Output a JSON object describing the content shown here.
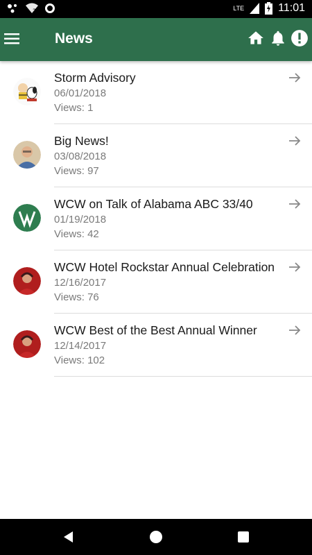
{
  "status_bar": {
    "time": "11:01",
    "network": "LTE",
    "icons": [
      "notification-dots-icon",
      "wifi-icon",
      "circle-icon",
      "signal-icon",
      "battery-charging-icon"
    ]
  },
  "app_bar": {
    "title": "News",
    "menu_icon": "hamburger-menu-icon",
    "actions": [
      "home-icon",
      "bell-icon",
      "alert-icon"
    ],
    "background_color": "#2e6f4c"
  },
  "news": [
    {
      "title": "Storm Advisory",
      "date": "06/01/2018",
      "views": "Views: 1",
      "avatar": "cartoon-avatar"
    },
    {
      "title": "Big News!",
      "date": "03/08/2018",
      "views": "Views: 97",
      "avatar": "person-avatar"
    },
    {
      "title": "WCW on Talk of Alabama ABC 33/40",
      "date": "01/19/2018",
      "views": "Views: 42",
      "avatar": "wcw-logo-avatar"
    },
    {
      "title": "WCW Hotel Rockstar Annual Celebration",
      "date": "12/16/2017",
      "views": "Views: 76",
      "avatar": "person-red-avatar"
    },
    {
      "title": "WCW Best of the Best Annual Winner",
      "date": "12/14/2017",
      "views": "Views: 102",
      "avatar": "person-red-avatar"
    }
  ],
  "nav_bar": {
    "icons": [
      "back-icon",
      "home-circle-icon",
      "recents-square-icon"
    ]
  }
}
